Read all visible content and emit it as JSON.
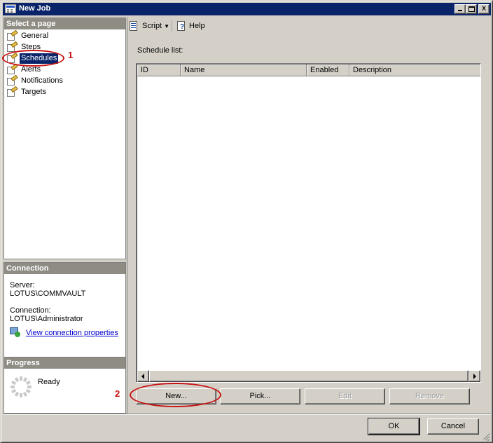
{
  "window": {
    "title": "New Job",
    "minimize": "_",
    "maximize": "□",
    "close": "X"
  },
  "left": {
    "pages_header": "Select a page",
    "pages": [
      {
        "label": "General",
        "icon": "page-wrench-icon"
      },
      {
        "label": "Steps",
        "icon": "page-wrench-icon"
      },
      {
        "label": "Schedules",
        "icon": "page-wrench-icon",
        "selected": true
      },
      {
        "label": "Alerts",
        "icon": "page-wrench-icon"
      },
      {
        "label": "Notifications",
        "icon": "page-wrench-icon"
      },
      {
        "label": "Targets",
        "icon": "page-wrench-icon"
      }
    ],
    "connection_header": "Connection",
    "server_label": "Server:",
    "server_value": "LOTUS\\COMMVAULT",
    "connection_label": "Connection:",
    "connection_value": "LOTUS\\Administrator",
    "view_link": "View connection properties",
    "progress_header": "Progress",
    "progress_status": "Ready"
  },
  "toolbar": {
    "script": "Script",
    "help": "Help"
  },
  "main": {
    "schedule_list_label": "Schedule list:",
    "columns": [
      "ID",
      "Name",
      "Enabled",
      "Description"
    ],
    "rows": []
  },
  "buttons": {
    "new": "New...",
    "pick": "Pick...",
    "edit": "Edit",
    "remove": "Remove",
    "ok": "OK",
    "cancel": "Cancel"
  },
  "annotations": {
    "marker1": "1",
    "marker2": "2",
    "color": "#c81414"
  },
  "colors": {
    "titlebar": "#0a246a",
    "panel_header": "#8f8c84",
    "link": "#0000cc"
  }
}
